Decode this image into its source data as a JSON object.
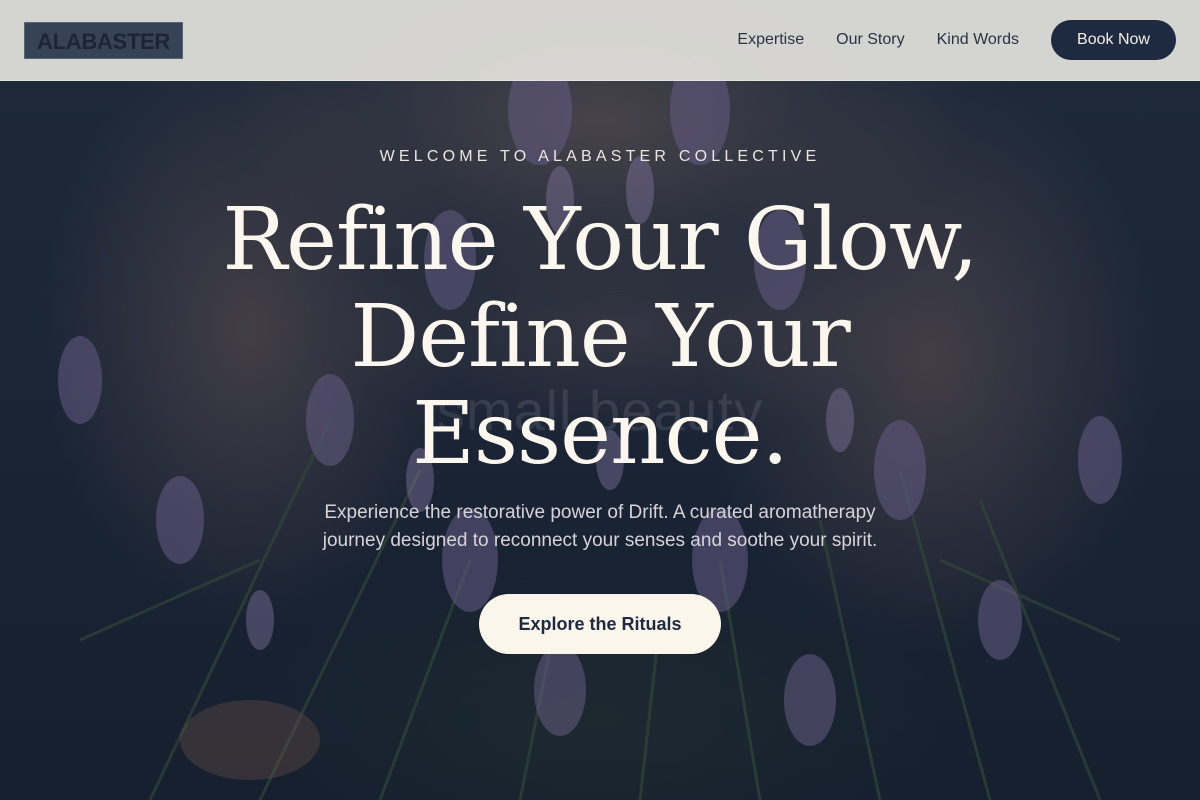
{
  "header": {
    "logo": "ALABASTER",
    "nav": [
      {
        "label": "Expertise"
      },
      {
        "label": "Our Story"
      },
      {
        "label": "Kind Words"
      }
    ],
    "book_label": "Book Now"
  },
  "hero": {
    "eyebrow": "WELCOME TO ALABASTER COLLECTIVE",
    "headline_line1": "Refine Your Glow,",
    "headline_line2": "Define Your",
    "headline_line3": "Essence.",
    "ghost_text": "small beauty",
    "subtitle_line1": "Experience the restorative power of Drift. A curated aromatherapy",
    "subtitle_line2": "journey designed to reconnect your senses and soothe your spirit.",
    "cta_label": "Explore the Rituals"
  },
  "colors": {
    "navy": "#1e2a40",
    "cream": "#fbf6ec",
    "header_bg": "#e2e1db"
  }
}
